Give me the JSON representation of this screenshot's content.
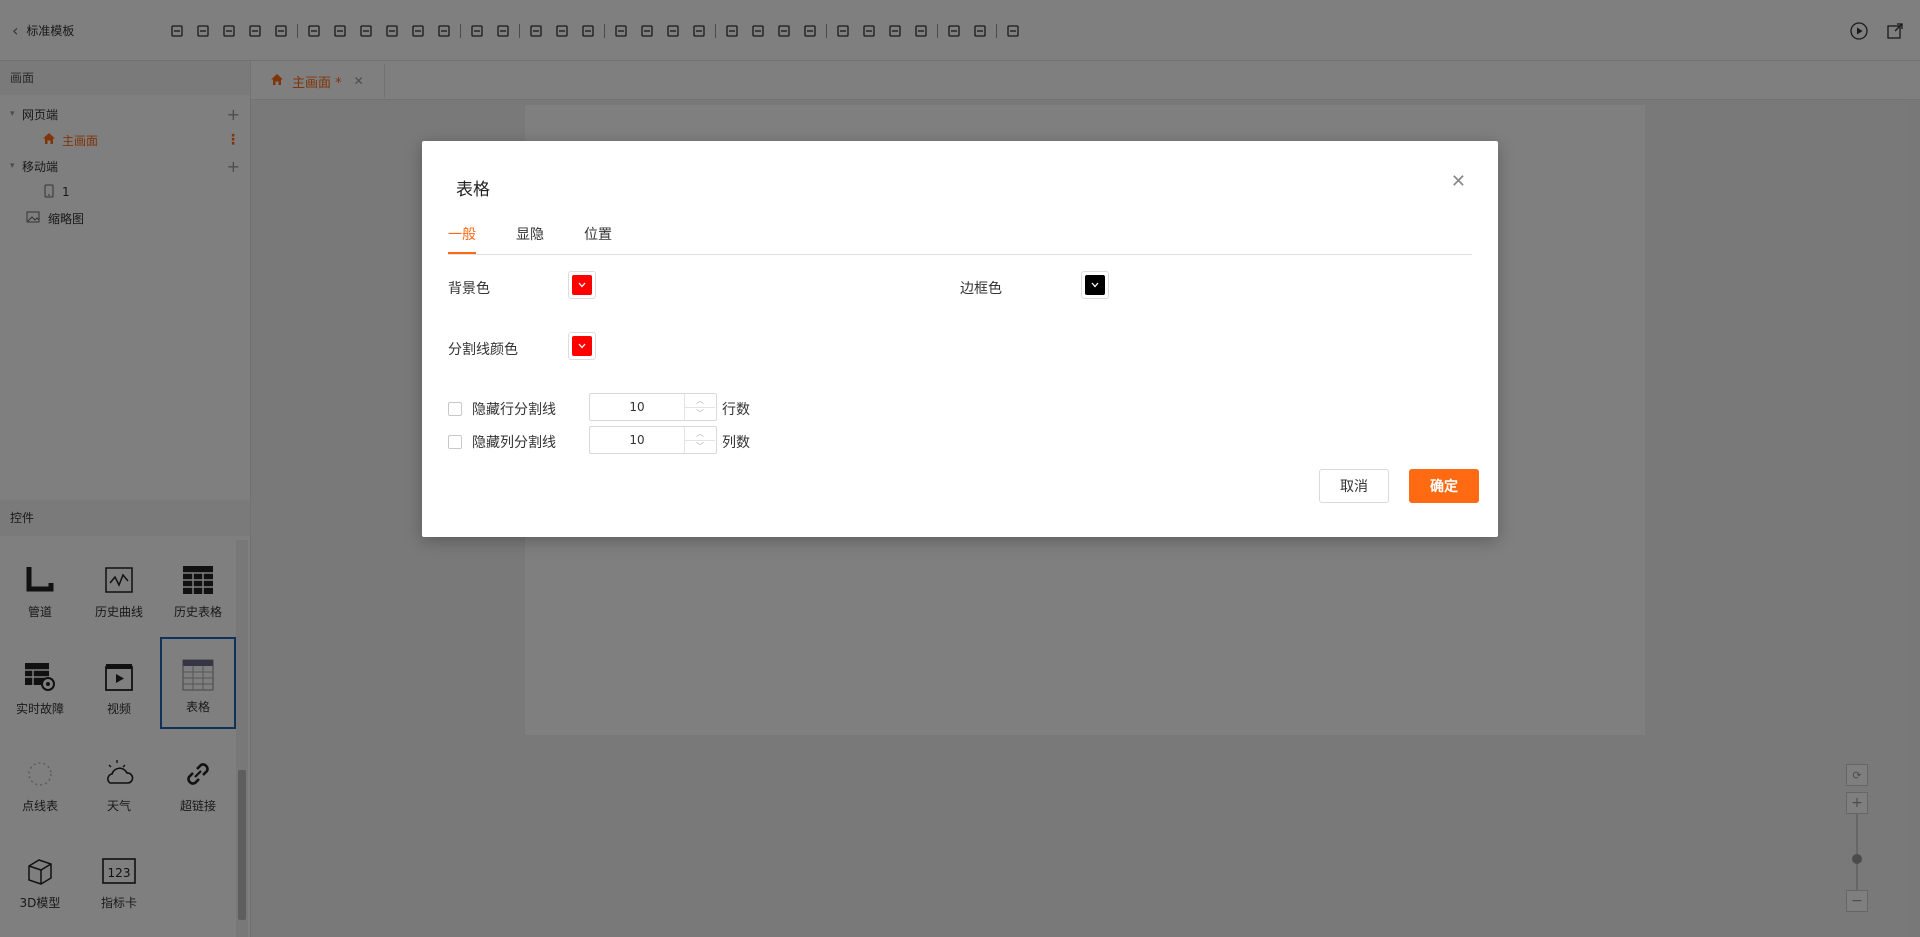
{
  "app": {
    "back_label": "标准模板"
  },
  "toolbar": {
    "icons": [
      "save-icon",
      "save-as-icon",
      "cut-icon",
      "paste-icon",
      "delete-icon",
      "align-left-icon",
      "align-right-icon",
      "align-top-icon",
      "align-bottom-icon",
      "align-center-h-icon",
      "align-center-v-icon",
      "distribute-h-icon",
      "distribute-v-icon",
      "same-width-icon",
      "same-height-icon",
      "same-size-icon",
      "group-icon",
      "ungroup-icon",
      "lock-icon",
      "unlock-icon",
      "bring-front-icon",
      "send-back-icon",
      "bring-forward-icon",
      "send-backward-icon",
      "undo-icon",
      "redo-icon",
      "image-icon",
      "layers-icon",
      "text-icon",
      "media-icon",
      "swap-icon"
    ]
  },
  "sidebar": {
    "screens_header": "画面",
    "tree": {
      "web": "网页端",
      "main_screen": "主画面",
      "mobile": "移动端",
      "mobile_page": "1",
      "thumbnail": "缩略图"
    },
    "controls_header": "控件",
    "controls": [
      {
        "label": "管道",
        "icon": "pipe-icon"
      },
      {
        "label": "历史曲线",
        "icon": "history-curve-icon"
      },
      {
        "label": "历史表格",
        "icon": "history-table-icon"
      },
      {
        "label": "实时故障",
        "icon": "realtime-fault-icon"
      },
      {
        "label": "视频",
        "icon": "video-icon"
      },
      {
        "label": "表格",
        "icon": "table-icon"
      },
      {
        "label": "点线表",
        "icon": "dot-line-table-icon"
      },
      {
        "label": "天气",
        "icon": "weather-icon"
      },
      {
        "label": "超链接",
        "icon": "hyperlink-icon"
      },
      {
        "label": "3D模型",
        "icon": "3d-model-icon"
      },
      {
        "label": "指标卡",
        "icon": "indicator-card-icon"
      }
    ]
  },
  "editor": {
    "tab_label": "主画面 *"
  },
  "dialog": {
    "title": "表格",
    "tabs": [
      "一般",
      "显隐",
      "位置"
    ],
    "bg_color_label": "背景色",
    "border_color_label": "边框色",
    "divider_color_label": "分割线颜色",
    "hide_row_label": "隐藏行分割线",
    "hide_col_label": "隐藏列分割线",
    "rows_value": "10",
    "rows_label": "行数",
    "cols_value": "10",
    "cols_label": "列数",
    "cancel_label": "取消",
    "ok_label": "确定"
  },
  "colors": {
    "accent": "#ff6a13",
    "bg_color": "#ff0000",
    "border_color": "#000000",
    "divider_color": "#ff0000"
  }
}
